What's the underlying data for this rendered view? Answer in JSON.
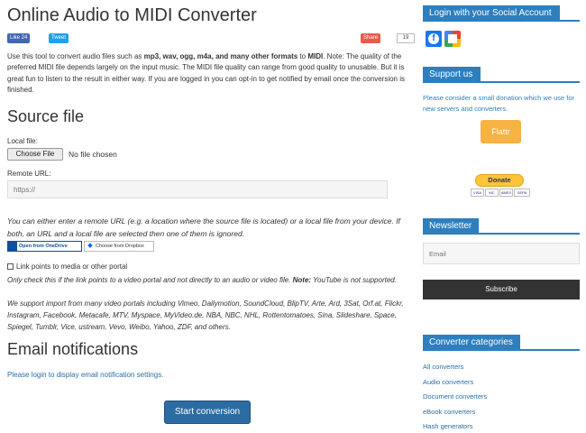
{
  "page": {
    "title": "Online Audio to MIDI Converter"
  },
  "social": {
    "like_label": "Like 24",
    "tweet_label": "Tweet",
    "share_label": "Share",
    "share_count": "19"
  },
  "intro": {
    "part1": "Use this tool to convert audio files such as ",
    "formats_bold": "mp3, wav, ogg, m4a, and many other formats",
    "part2": " to ",
    "midi_bold": "MIDI",
    "part3": ". Note: The quality of the preferred MIDI file depends largely on the input music. The MIDI file quality can range from good quality to unusable. But it is great fun to listen to the result in either way. If you are logged in you can opt-in to get notified by email once the conversion is finished."
  },
  "source": {
    "heading": "Source file",
    "local_label": "Local file:",
    "choose_file_label": "Choose File",
    "no_file_text": "No file chosen",
    "remote_label": "Remote URL:",
    "url_placeholder": "https://",
    "either_text": "You can either enter a remote URL (e.g. a location where the source file is located) or a local file from your device. If both, an URL and a local file are selected then one of them is ignored.",
    "onedrive_label": "Open from OneDrive",
    "dropbox_label": "Choose from Dropbox",
    "checkbox_label": "Link points to media or other portal",
    "only_check_text": "Only check this if the link points to a video portal and not directly to an audio or video file. ",
    "only_check_note": "Note:",
    "only_check_tail": " YouTube is not supported.",
    "portals_text": "We support import from many video portals including Vimeo, Dailymotion, SoundCloud, BlipTV, Arte, Ard, 3Sat, Orf.at, Flickr, Instagram, Facebook, Metacafe, MTV, Myspace, MyVideo.de, NBA, NBC, NHL, Rottentomatoes, Sina, Slideshare, Space, Spiegel, Tumblr, Vice, ustream, Vevo, Weibo, Yahoo, ZDF, and others."
  },
  "email": {
    "heading": "Email notifications",
    "login_text": "Please login to display email notification settings."
  },
  "start_button": "Start conversion",
  "sidebar": {
    "social_login_title": "Login with your Social Account",
    "support_title": "Support us",
    "support_text": "Please consider a small donation which we use for new servers and converters.",
    "flattr_label": "Flattr",
    "donate_label": "Donate",
    "cards": [
      "VISA",
      "MC",
      "AMEX",
      "SEPA"
    ],
    "newsletter_title": "Newsletter",
    "email_placeholder": "Email",
    "subscribe_label": "Subscribe",
    "categories_title": "Converter categories",
    "categories": [
      "All converters",
      "Audio converters",
      "Document converters",
      "eBook converters",
      "Hash generators"
    ]
  },
  "colors": {
    "accent": "#2d7fbf",
    "button": "#2b6ca3",
    "link": "#2a6ca8",
    "flattr": "#f6b243",
    "donate": "#ffc439"
  },
  "icons": {
    "facebook": "facebook-icon",
    "google": "google-icon",
    "onedrive": "onedrive-icon",
    "dropbox": "dropbox-icon"
  }
}
